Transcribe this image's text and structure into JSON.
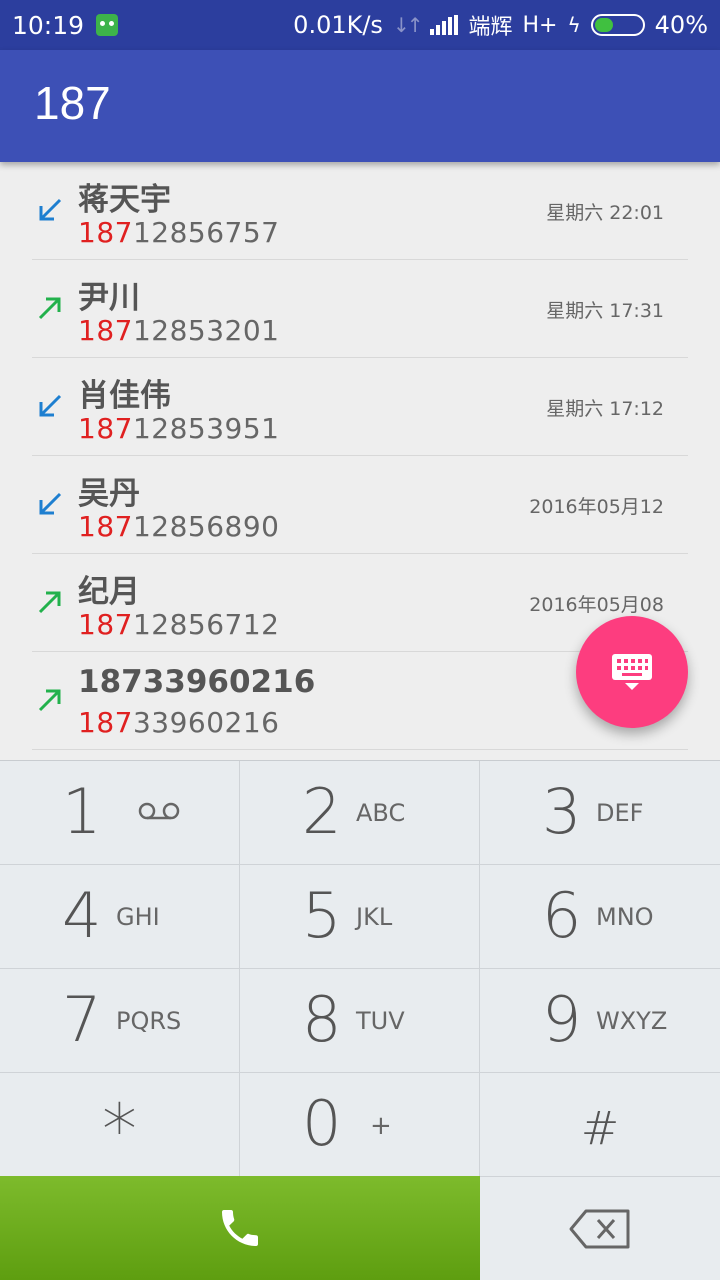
{
  "status_bar": {
    "time": "10:19",
    "net_speed": "0.01K/s",
    "carrier": "端辉",
    "network": "H+",
    "battery": "40%",
    "battery_level": 0.4
  },
  "toolbar": {
    "title": "187"
  },
  "calls": [
    {
      "direction": "incoming",
      "name": "蒋天宇",
      "match": "187",
      "rest": "12856757",
      "date": "星期六 22:01"
    },
    {
      "direction": "outgoing",
      "name": "尹川",
      "match": "187",
      "rest": "12853201",
      "date": "星期六 17:31"
    },
    {
      "direction": "incoming",
      "name": "肖佳伟",
      "match": "187",
      "rest": "12853951",
      "date": "星期六 17:12"
    },
    {
      "direction": "incoming",
      "name": "吴丹",
      "match": "187",
      "rest": "12856890",
      "date": "2016年05月12"
    },
    {
      "direction": "outgoing",
      "name": "纪月",
      "match": "187",
      "rest": "12856712",
      "date": "2016年05月08"
    },
    {
      "direction": "outgoing",
      "name": "18733960216",
      "match": "187",
      "rest": "33960216",
      "date": "2016-"
    }
  ],
  "colors": {
    "incoming": "#1e7fd0",
    "outgoing": "#22b14c",
    "fab": "#fd3d7f",
    "toolbar": "#3d50b6"
  },
  "icons": {
    "fab": "keyboard-icon",
    "call": "phone-icon",
    "backspace": "backspace-icon",
    "voicemail": "voicemail-icon"
  },
  "keys": [
    {
      "digit": "1",
      "letters": ""
    },
    {
      "digit": "2",
      "letters": "ABC"
    },
    {
      "digit": "3",
      "letters": "DEF"
    },
    {
      "digit": "4",
      "letters": "GHI"
    },
    {
      "digit": "5",
      "letters": "JKL"
    },
    {
      "digit": "6",
      "letters": "MNO"
    },
    {
      "digit": "7",
      "letters": "PQRS"
    },
    {
      "digit": "8",
      "letters": "TUV"
    },
    {
      "digit": "9",
      "letters": "WXYZ"
    },
    {
      "digit": "*",
      "letters": ""
    },
    {
      "digit": "0",
      "letters": "+"
    },
    {
      "digit": "#",
      "letters": ""
    }
  ]
}
